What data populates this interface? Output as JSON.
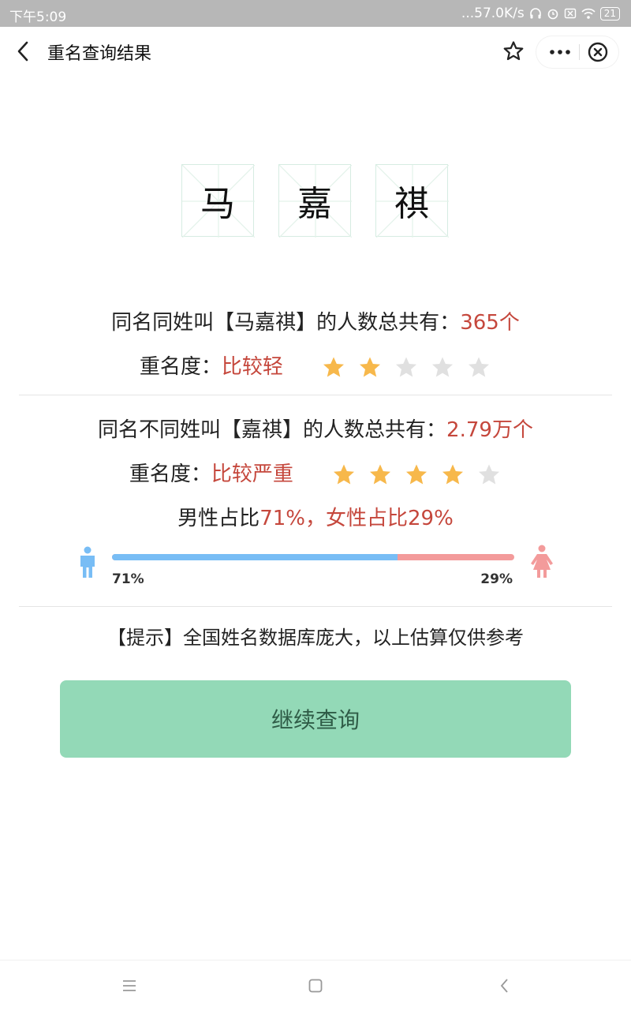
{
  "status_bar": {
    "time": "下午5:09",
    "network_speed": "...57.0K/s",
    "battery": "21"
  },
  "nav": {
    "title": "重名查询结果"
  },
  "name": {
    "characters": [
      "马",
      "嘉",
      "祺"
    ]
  },
  "same_full_name": {
    "prefix": "同名同姓叫【马嘉祺】的人数总共有：",
    "count": "365个",
    "degree_label": "重名度：",
    "degree_value": "比较轻",
    "stars_filled": 2,
    "stars_total": 5
  },
  "same_given_name": {
    "prefix": "同名不同姓叫【嘉祺】的人数总共有：",
    "count": "2.79万个",
    "degree_label": "重名度：",
    "degree_value": "比较严重",
    "stars_filled": 4,
    "stars_total": 5
  },
  "gender": {
    "ratio_label": "男性占比",
    "male_pct_text": "71%",
    "separator": "，",
    "female_label": "女性占比",
    "female_pct_text": "29%",
    "male_fraction": 0.71,
    "male_color": "#78bdf5",
    "female_color": "#f39b9b"
  },
  "tip": "【提示】全国姓名数据库庞大，以上估算仅供参考",
  "continue_button": "继续查询",
  "colors": {
    "accent_red": "#c5473c",
    "button_bg": "#93d9b7",
    "star_filled": "#f7b84b",
    "star_empty": "#e0e0e0"
  },
  "icons": {
    "back": "back-arrow-icon",
    "favorite": "star-outline-icon",
    "more": "more-dots-icon",
    "close": "close-circle-icon",
    "male": "male-person-icon",
    "female": "female-person-icon"
  }
}
